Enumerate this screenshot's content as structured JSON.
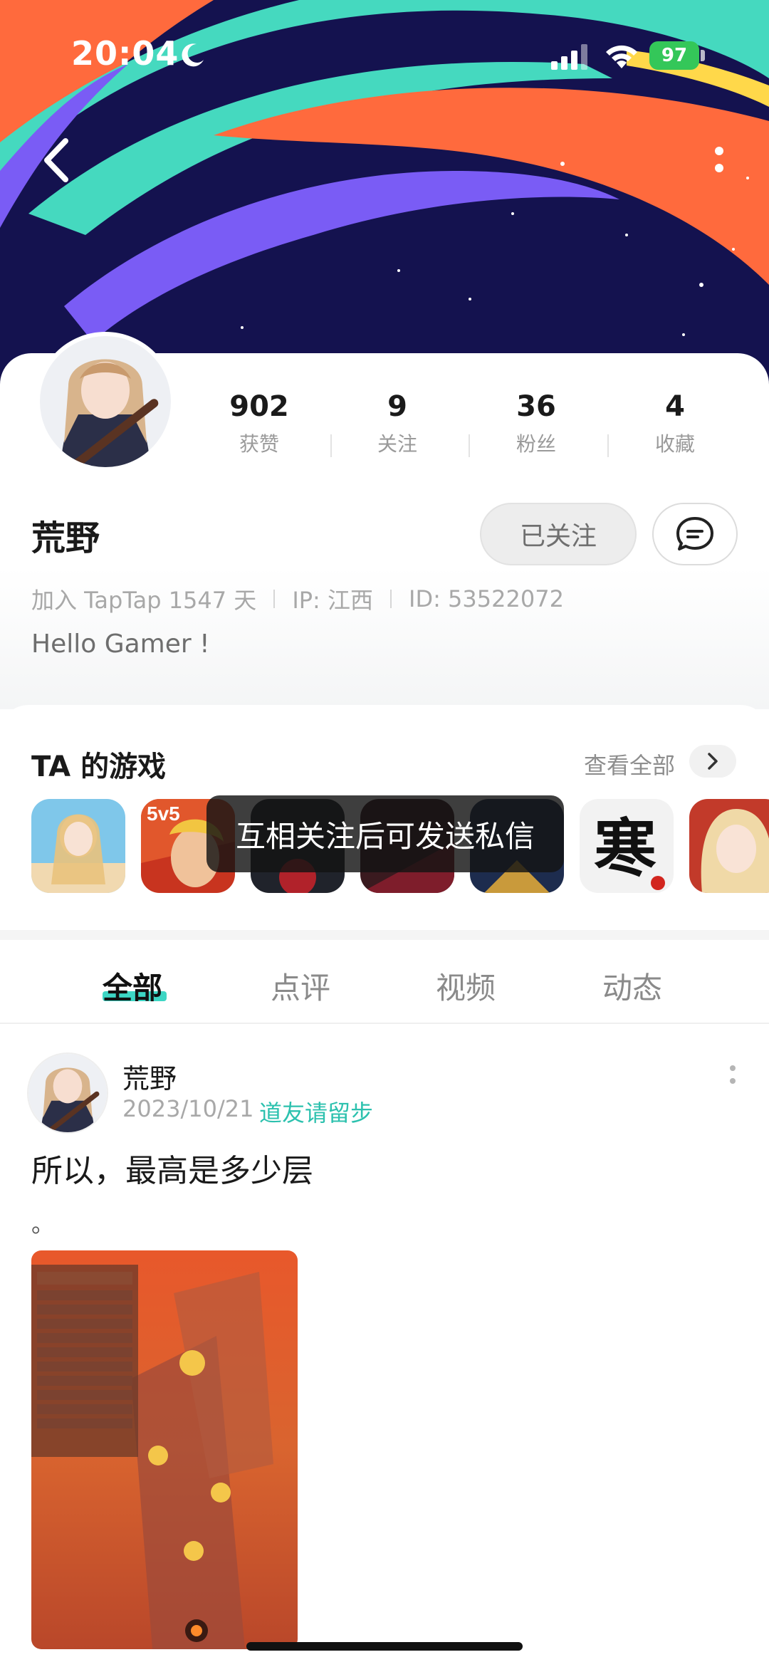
{
  "status_bar": {
    "time": "20:04",
    "battery": "97"
  },
  "profile": {
    "stats": [
      {
        "value": "902",
        "label": "获赞"
      },
      {
        "value": "9",
        "label": "关注"
      },
      {
        "value": "36",
        "label": "粉丝"
      },
      {
        "value": "4",
        "label": "收藏"
      }
    ],
    "username": "荒野",
    "follow_label": "已关注",
    "meta": {
      "joined": "加入 TapTap 1547 天",
      "ip": "IP: 江西",
      "id": "ID: 53522072"
    },
    "bio": "Hello Gamer !"
  },
  "games": {
    "title": "TA 的游戏",
    "see_all": "查看全部",
    "icons": [
      "game-icon-anime-girl",
      "game-icon-5v5",
      "game-icon-dark",
      "game-icon-red",
      "game-icon-warrior",
      "game-icon-han",
      "game-icon-blonde"
    ],
    "badge_5v5": "5v5",
    "badge_han": "寒"
  },
  "toast": "互相关注后可发送私信",
  "tabs": [
    "全部",
    "点评",
    "视频",
    "动态"
  ],
  "post": {
    "author": "荒野",
    "date": "2023/10/21",
    "tag": "道友请留步",
    "title": "所以，最高是多少层",
    "body": "。"
  },
  "colors": {
    "accent": "#2cc1ae",
    "tab_underline": "#3dd6c4",
    "banner_bg": "#14124f"
  }
}
